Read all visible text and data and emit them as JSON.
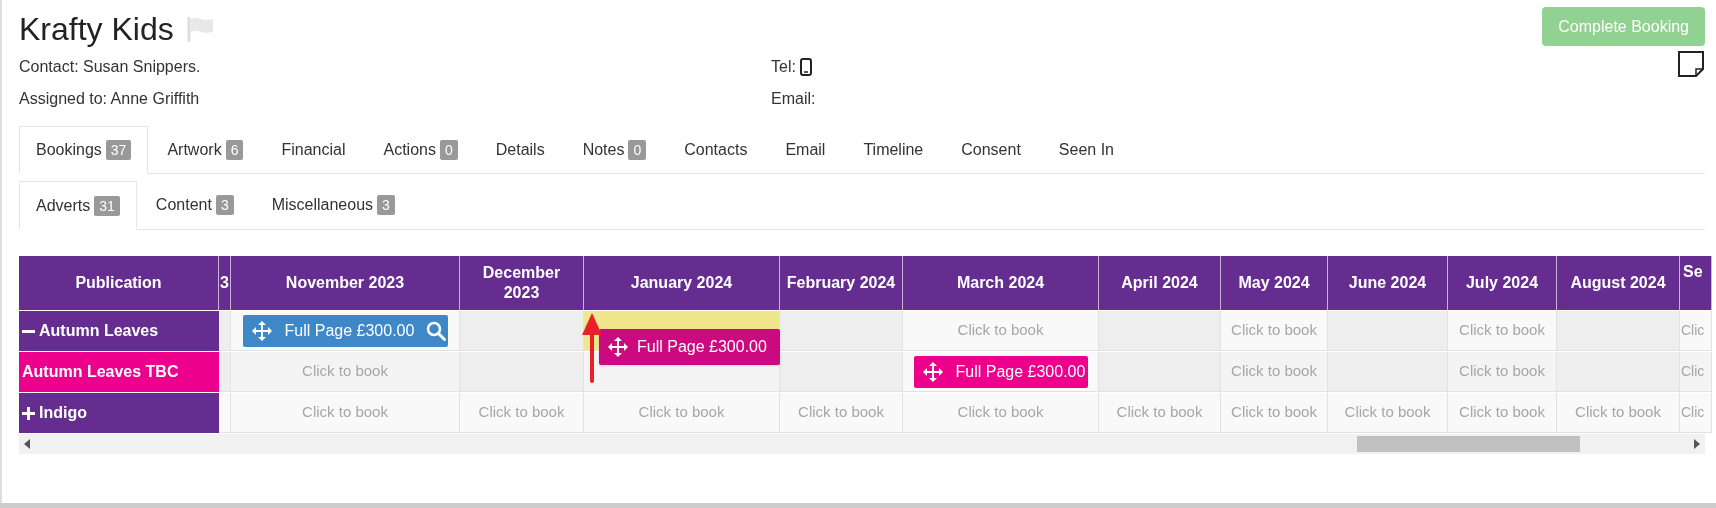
{
  "header": {
    "title": "Krafty Kids",
    "contact": "Contact: Susan Snippers.",
    "assigned": "Assigned to: Anne Griffith",
    "tel_label": "Tel:",
    "email_label": "Email:",
    "action_button": "Complete Booking"
  },
  "tabs": [
    {
      "label": "Bookings",
      "count": "37",
      "selected": true
    },
    {
      "label": "Artwork",
      "count": "6",
      "selected": false
    },
    {
      "label": "Financial",
      "selected": false
    },
    {
      "label": "Actions",
      "count": "0",
      "selected": false
    },
    {
      "label": "Details",
      "selected": false
    },
    {
      "label": "Notes",
      "count": "0",
      "selected": false
    },
    {
      "label": "Contacts",
      "selected": false
    },
    {
      "label": "Email",
      "selected": false
    },
    {
      "label": "Timeline",
      "selected": false
    },
    {
      "label": "Consent",
      "selected": false
    },
    {
      "label": "Seen In",
      "selected": false
    }
  ],
  "subtabs": [
    {
      "label": "Adverts",
      "count": "31",
      "selected": true
    },
    {
      "label": "Content",
      "count": "3",
      "selected": false
    },
    {
      "label": "Miscellaneous",
      "count": "3",
      "selected": false
    }
  ],
  "grid": {
    "corner": "Publication",
    "columns": [
      "3",
      "November 2023",
      "December 2023",
      "January 2024",
      "February 2024",
      "March 2024",
      "April 2024",
      "May 2024",
      "June 2024",
      "July 2024",
      "August 2024",
      "Se"
    ],
    "rows": [
      {
        "label": "Autumn Leaves",
        "kind": "expanded",
        "cells": [
          {
            "kind": "empty"
          },
          {
            "kind": "booking",
            "text": "Full Page £300.00",
            "color": "#3f88c8",
            "search": true
          },
          {
            "kind": "empty"
          },
          {
            "kind": "drop-target"
          },
          {
            "kind": "empty"
          },
          {
            "kind": "bookable",
            "text": "Click to book"
          },
          {
            "kind": "empty"
          },
          {
            "kind": "bookable",
            "text": "Click to book"
          },
          {
            "kind": "empty"
          },
          {
            "kind": "bookable",
            "text": "Click to book"
          },
          {
            "kind": "empty"
          },
          {
            "kind": "bookable",
            "text": "Clic"
          }
        ]
      },
      {
        "label": "Autumn Leaves TBC",
        "kind": "tbc",
        "cells": [
          {
            "kind": "empty"
          },
          {
            "kind": "bookable",
            "text": "Click to book"
          },
          {
            "kind": "empty"
          },
          {
            "kind": "bookable"
          },
          {
            "kind": "empty"
          },
          {
            "kind": "booking",
            "text": "Full Page £300.00",
            "color": "#ec008c",
            "search": false
          },
          {
            "kind": "empty"
          },
          {
            "kind": "bookable",
            "text": "Click to book"
          },
          {
            "kind": "empty"
          },
          {
            "kind": "bookable",
            "text": "Click to book"
          },
          {
            "kind": "empty"
          },
          {
            "kind": "bookable",
            "text": "Clic"
          }
        ]
      },
      {
        "label": "Indigo",
        "kind": "collapsed",
        "cells": [
          {
            "kind": "bookable"
          },
          {
            "kind": "bookable",
            "text": "Click to book"
          },
          {
            "kind": "bookable",
            "text": "Click to book"
          },
          {
            "kind": "bookable",
            "text": "Click to book"
          },
          {
            "kind": "bookable",
            "text": "Click to book"
          },
          {
            "kind": "bookable",
            "text": "Click to book"
          },
          {
            "kind": "bookable",
            "text": "Click to book"
          },
          {
            "kind": "bookable",
            "text": "Click to book"
          },
          {
            "kind": "bookable",
            "text": "Click to book"
          },
          {
            "kind": "bookable",
            "text": "Click to book"
          },
          {
            "kind": "bookable",
            "text": "Click to book"
          },
          {
            "kind": "bookable",
            "text": "Clic"
          }
        ]
      }
    ],
    "dragging": {
      "text": "Full Page £300.00",
      "color": "#cc0a7f"
    }
  }
}
